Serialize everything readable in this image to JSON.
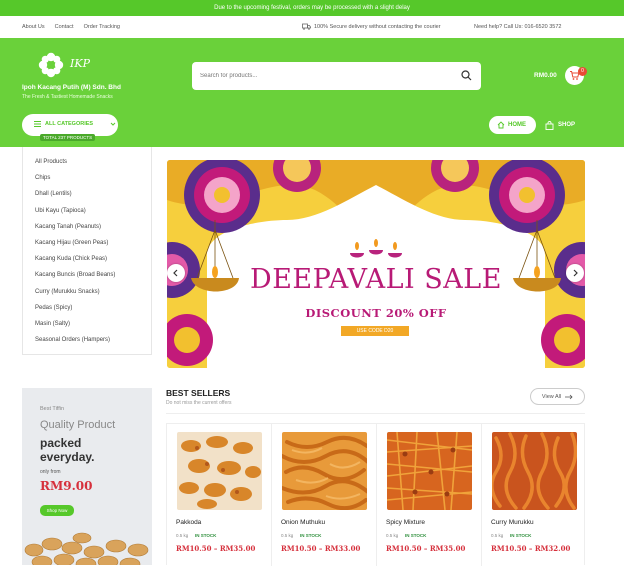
{
  "announcement": "Due to the upcoming festival, orders may be processed with a slight delay",
  "infobar": {
    "links": [
      "About Us",
      "Contact",
      "Order Tracking"
    ],
    "shipping": "100% Secure delivery without contacting the courier",
    "help": "Need help? Call Us: 016-6520 3572"
  },
  "logo": {
    "script": "IKP",
    "company": "Ipoh Kacang Putih (M) Sdn. Bhd",
    "tagline": "The Fresh & Tastiest Homemade Snacks"
  },
  "search": {
    "placeholder": "Search for products..."
  },
  "cart": {
    "total": "RM0.00",
    "count": "0"
  },
  "nav": {
    "all_categories": "ALL CATEGORIES",
    "categories_count": "TOTAL 237 PRODUCTS",
    "home": "HOME",
    "shop": "SHOP"
  },
  "categories": [
    "All Products",
    "Chips",
    "Dhall (Lentils)",
    "Ubi Kayu (Tapioca)",
    "Kacang Tanah (Peanuts)",
    "Kacang Hijau (Green Peas)",
    "Kacang Kuda (Chick Peas)",
    "Kacang Buncis (Broad Beans)",
    "Curry (Murukku Snacks)",
    "Pedas (Spicy)",
    "Masin (Salty)",
    "Seasonal Orders (Hampers)"
  ],
  "hero": {
    "title": "DEEPAVALI SALE",
    "discount": "DISCOUNT 20% OFF",
    "code": "USE CODE D20",
    "colors": {
      "magenta": "#b81a76",
      "gold": "#f6cf3d",
      "purple": "#5a2d8c"
    }
  },
  "promo": {
    "pretitle": "Best Tiffin",
    "line1": "Quality Product",
    "line2": "packed",
    "line3": "everyday.",
    "only": "only from",
    "price": "RM9.00",
    "button": "Shop Now"
  },
  "bestsellers": {
    "title": "BEST SELLERS",
    "subtitle": "Do not miss the current offers",
    "view_all": "View All",
    "products": [
      {
        "name": "Pakkoda",
        "weight": "0.5 kg",
        "stock": "IN STOCK",
        "price": "RM10.50 – RM35.00"
      },
      {
        "name": "Onion Muthuku",
        "weight": "0.5 kg",
        "stock": "IN STOCK",
        "price": "RM10.50 – RM33.00"
      },
      {
        "name": "Spicy Mixture",
        "weight": "0.5 kg",
        "stock": "IN STOCK",
        "price": "RM10.50 – RM35.00"
      },
      {
        "name": "Curry Murukku",
        "weight": "0.5 kg",
        "stock": "IN STOCK",
        "price": "RM10.50 – RM32.00"
      }
    ]
  },
  "brand_green": "#6ad13a"
}
